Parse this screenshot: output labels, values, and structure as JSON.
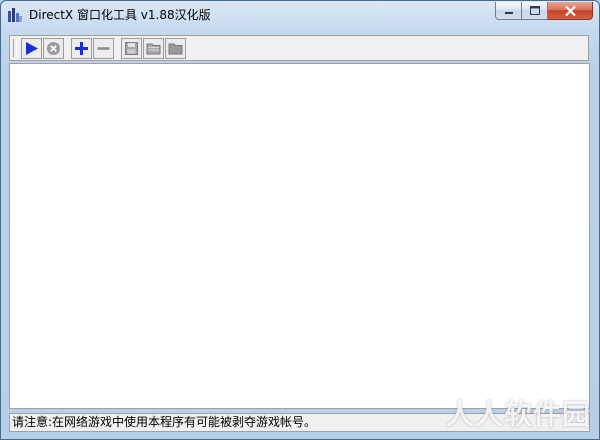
{
  "window": {
    "title": "DirectX 窗口化工具 v1.88汉化版"
  },
  "caption": {
    "minimize_icon": "minimize-icon",
    "maximize_icon": "maximize-icon",
    "close_icon": "close-icon"
  },
  "toolbar": {
    "buttons": [
      {
        "icon": "play-icon",
        "color": "#1a2fd0",
        "enabled": true
      },
      {
        "icon": "stop-icon",
        "color": "#8a8a8a",
        "enabled": false
      },
      {
        "icon": "add-icon",
        "color": "#1a2fd0",
        "enabled": true
      },
      {
        "icon": "remove-icon",
        "color": "#8a8a8a",
        "enabled": false
      },
      {
        "icon": "save-icon",
        "color": "#8a8a8a",
        "enabled": false
      },
      {
        "icon": "open-folder-icon",
        "color": "#8a8a8a",
        "enabled": false
      },
      {
        "icon": "folder-icon",
        "color": "#8a8a8a",
        "enabled": false
      }
    ]
  },
  "statusbar": {
    "text": "请注意:在网络游戏中使用本程序有可能被剥夺游戏帐号。"
  },
  "watermark": {
    "text": "人人软件园"
  }
}
